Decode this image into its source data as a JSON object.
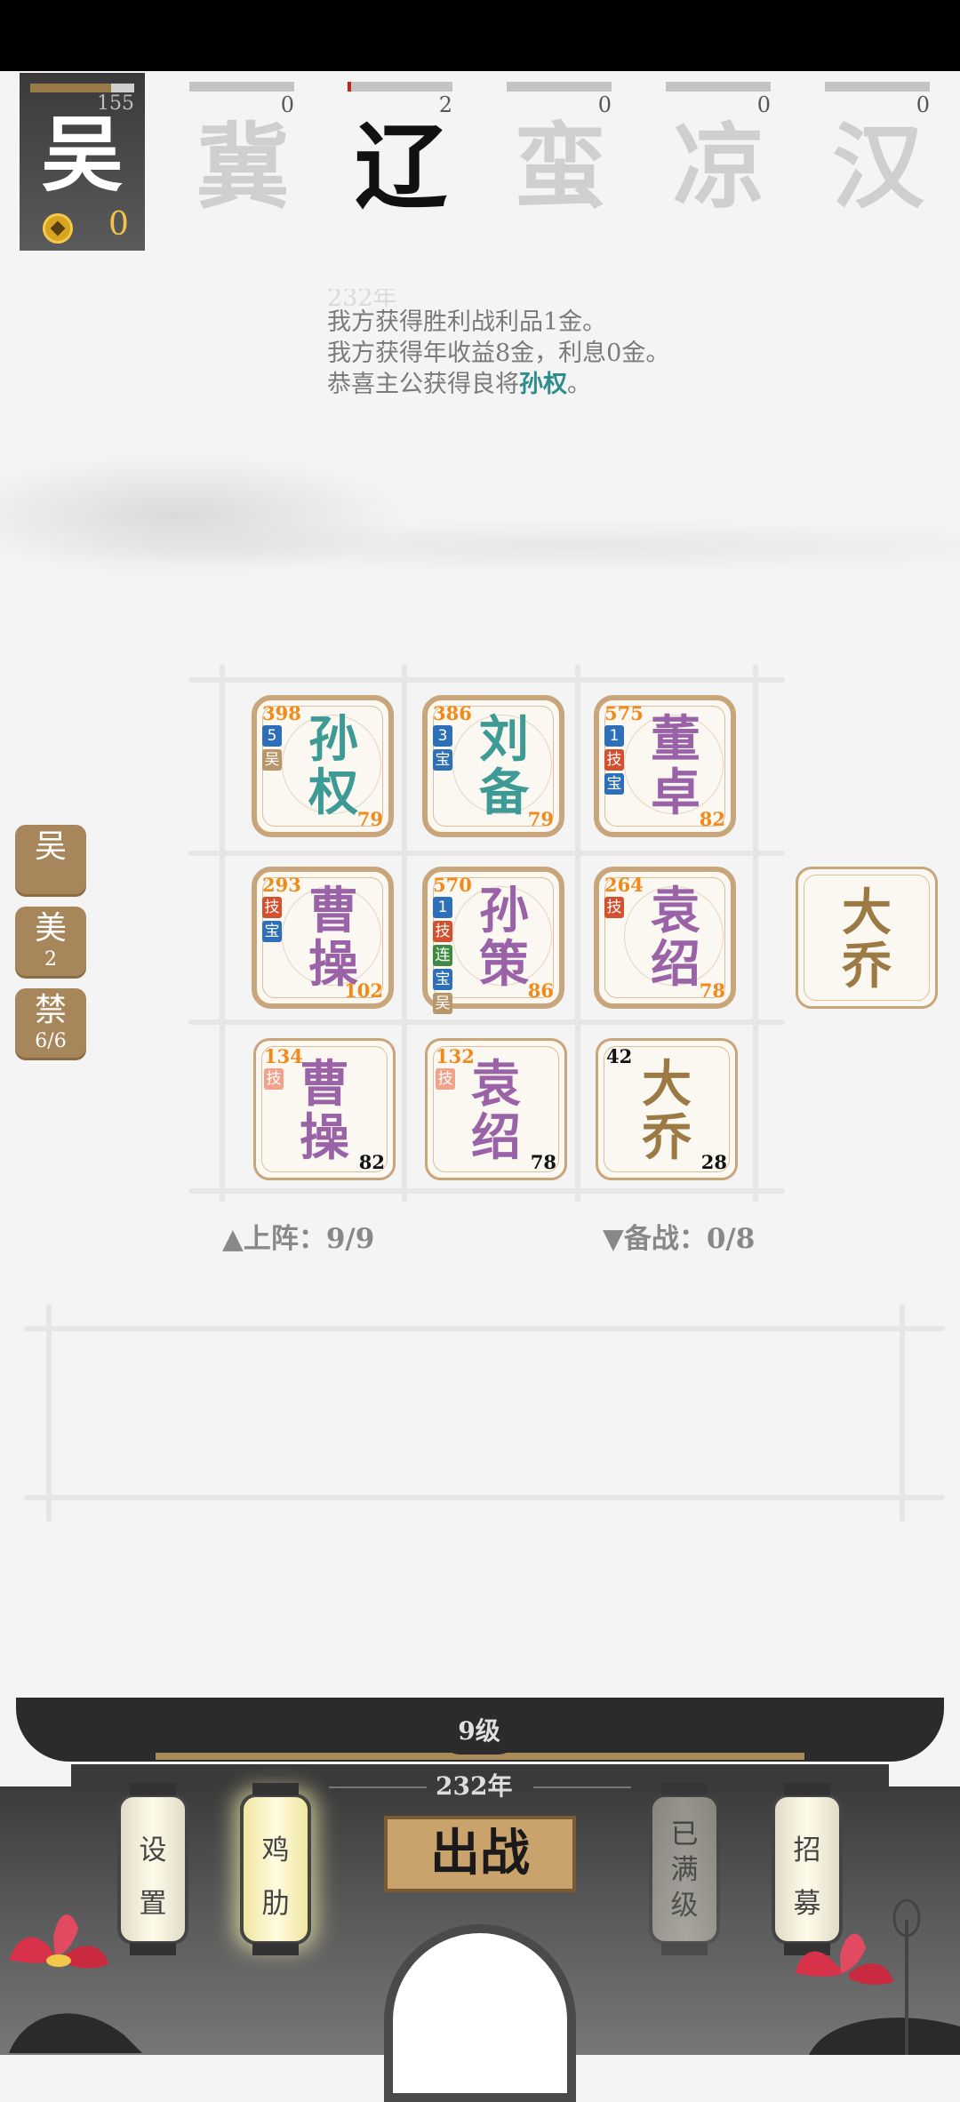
{
  "player": {
    "faction_char": "吴",
    "count": "155",
    "hp_fraction": 0.78,
    "gold": "0"
  },
  "enemies": [
    {
      "char": "冀",
      "count": "0",
      "hp_fraction": 0.0,
      "active": false
    },
    {
      "char": "辽",
      "count": "2",
      "hp_fraction": 0.03,
      "active": true
    },
    {
      "char": "蛮",
      "count": "0",
      "hp_fraction": 0.0,
      "active": false
    },
    {
      "char": "凉",
      "count": "0",
      "hp_fraction": 0.0,
      "active": false
    },
    {
      "char": "汉",
      "count": "0",
      "hp_fraction": 0.0,
      "active": false
    }
  ],
  "log": {
    "faded_line": "232年",
    "line1": "我方获得胜利战利品1金。",
    "line2": "我方获得年收益8金，利息0金。",
    "line3_prefix": "恭喜主公获得良将",
    "line3_name": "孙权",
    "line3_suffix": "。"
  },
  "units": [
    {
      "name1": "孙",
      "name2": "权",
      "atk": "398",
      "hp": "79",
      "tags": [
        {
          "t": "5",
          "c": "blue"
        },
        {
          "t": "吴",
          "c": "tan"
        }
      ],
      "color": "teal",
      "style": "ornate"
    },
    {
      "name1": "刘",
      "name2": "备",
      "atk": "386",
      "hp": "79",
      "tags": [
        {
          "t": "3",
          "c": "blue"
        },
        {
          "t": "宝",
          "c": "blue"
        }
      ],
      "color": "teal",
      "style": "ornate"
    },
    {
      "name1": "董",
      "name2": "卓",
      "atk": "575",
      "hp": "82",
      "tags": [
        {
          "t": "1",
          "c": "blue"
        },
        {
          "t": "技",
          "c": "red"
        },
        {
          "t": "宝",
          "c": "blue"
        }
      ],
      "color": "purple",
      "style": "ornate"
    },
    {
      "name1": "曹",
      "name2": "操",
      "atk": "293",
      "hp": "102",
      "tags": [
        {
          "t": "技",
          "c": "red"
        },
        {
          "t": "宝",
          "c": "blue"
        }
      ],
      "color": "purple",
      "style": "ornate"
    },
    {
      "name1": "孙",
      "name2": "策",
      "atk": "570",
      "hp": "86",
      "tags": [
        {
          "t": "1",
          "c": "blue"
        },
        {
          "t": "技",
          "c": "red"
        },
        {
          "t": "连",
          "c": "green"
        },
        {
          "t": "宝",
          "c": "blue"
        },
        {
          "t": "吴",
          "c": "tan"
        }
      ],
      "color": "purple",
      "style": "ornate"
    },
    {
      "name1": "袁",
      "name2": "绍",
      "atk": "264",
      "hp": "78",
      "tags": [
        {
          "t": "技",
          "c": "red"
        }
      ],
      "color": "purple",
      "style": "ornate"
    },
    {
      "name1": "曹",
      "name2": "操",
      "atk": "134",
      "hp": "82",
      "tags": [
        {
          "t": "技",
          "c": "pink"
        }
      ],
      "color": "purple",
      "style": "plain"
    },
    {
      "name1": "袁",
      "name2": "绍",
      "atk": "132",
      "hp": "78",
      "tags": [
        {
          "t": "技",
          "c": "pink"
        }
      ],
      "color": "purple",
      "style": "plain"
    },
    {
      "name1": "大",
      "name2": "乔",
      "atk": "42",
      "hp": "28",
      "tags": [],
      "color": "gold",
      "style": "plain"
    }
  ],
  "bench_unit": {
    "name1": "大",
    "name2": "乔"
  },
  "counters": {
    "deployed": "上阵：9/9",
    "reserve": "备战：0/8"
  },
  "side_buttons": [
    {
      "title": "吴",
      "sub": ""
    },
    {
      "title": "美",
      "sub": "2"
    },
    {
      "title": "禁",
      "sub": "6/6"
    }
  ],
  "footer": {
    "level": "9级",
    "year": "232年",
    "settings": "设置",
    "rib": "鸡肋",
    "maxed": "已满级",
    "recruit": "招募",
    "battle": "出战"
  },
  "colors": {
    "teal": "#3d9a95",
    "purple": "#9a63a8",
    "gold": "#9c7a44",
    "accent": "#c8a57a"
  }
}
